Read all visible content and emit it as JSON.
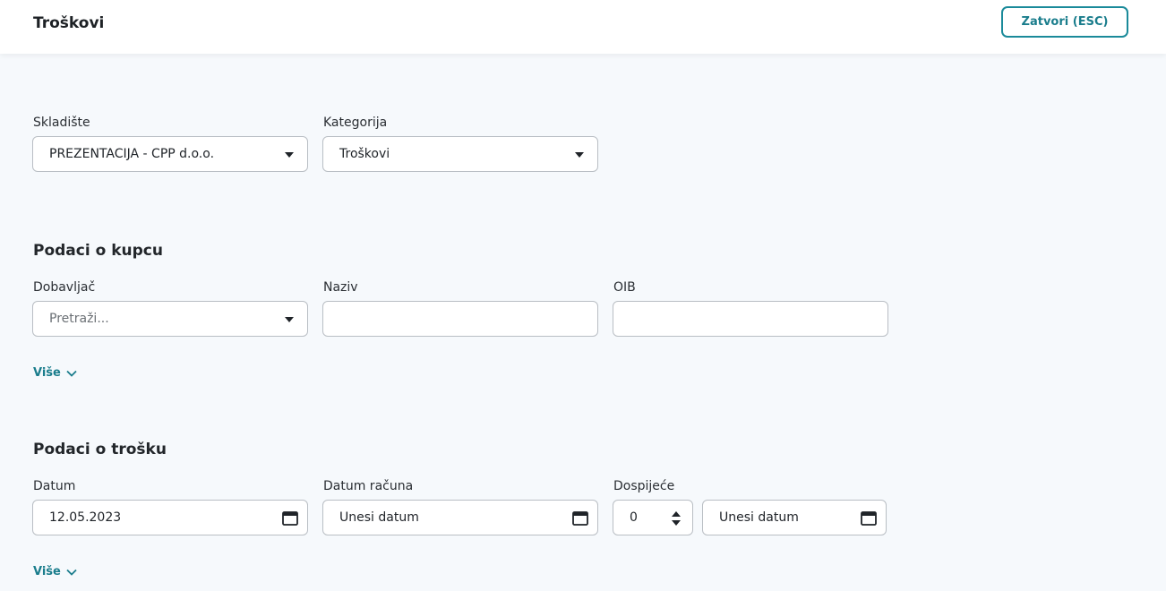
{
  "header": {
    "title": "Troškovi",
    "close_label": "Zatvori (ESC)"
  },
  "general": {
    "warehouse_label": "Skladište",
    "warehouse_value": "PREZENTACIJA - CPP d.o.o.",
    "category_label": "Kategorija",
    "category_value": "Troškovi"
  },
  "customer_section": {
    "title": "Podaci o kupcu",
    "supplier_label": "Dobavljač",
    "supplier_placeholder": "Pretraži...",
    "name_label": "Naziv",
    "name_value": "",
    "oib_label": "OIB",
    "oib_value": "",
    "more_label": "Više"
  },
  "expense_section": {
    "title": "Podaci o trošku",
    "date_label": "Datum",
    "date_value": "12.05.2023",
    "invoice_date_label": "Datum računa",
    "invoice_date_placeholder": "Unesi datum",
    "due_label": "Dospijeće",
    "due_days_value": "0",
    "due_date_placeholder": "Unesi datum",
    "more_label": "Više"
  },
  "icons": {
    "dropdown": "caret-down-icon",
    "calendar": "calendar-icon",
    "spinner": "spinner-arrows-icon",
    "expand": "chevron-down-icon"
  },
  "colors": {
    "accent": "#1a7d8c",
    "background": "#f6f9fc",
    "field_border": "#b9bec4"
  }
}
